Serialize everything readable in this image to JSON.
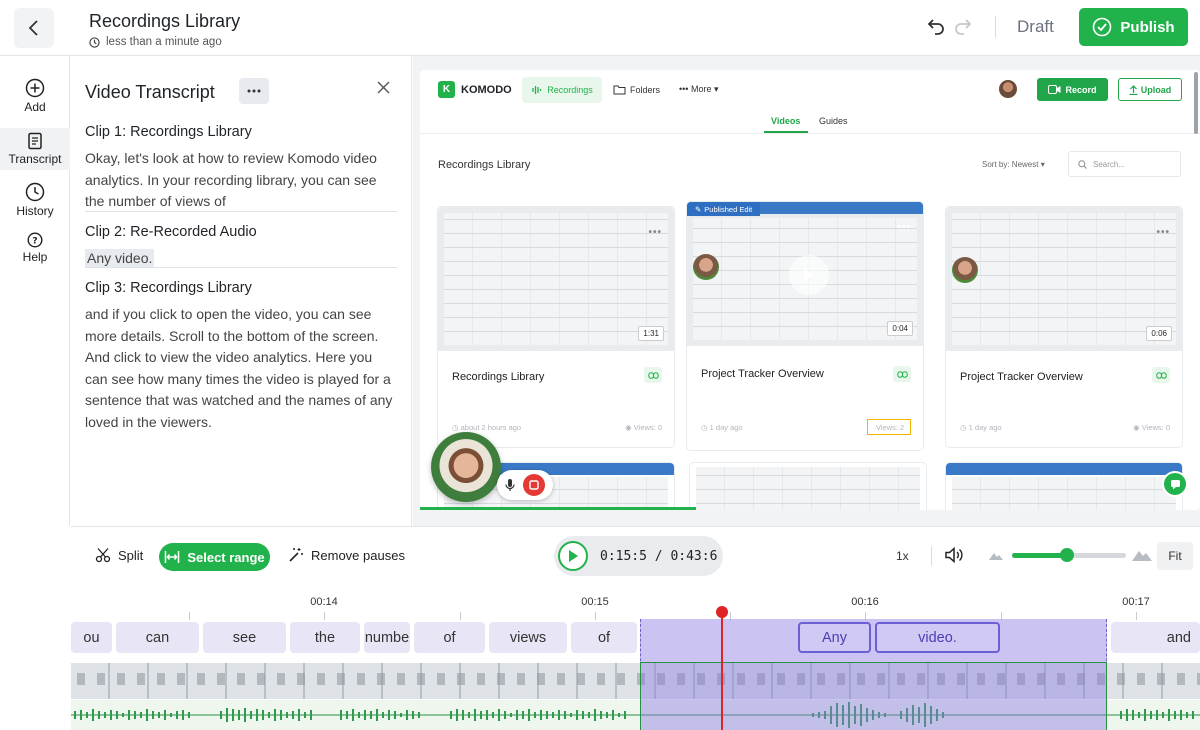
{
  "header": {
    "title": "Recordings Library",
    "subtitle": "less than a minute ago",
    "status": "Draft",
    "publish_label": "Publish"
  },
  "rail": {
    "items": [
      {
        "label": "Add"
      },
      {
        "label": "Transcript"
      },
      {
        "label": "History"
      },
      {
        "label": "Help"
      }
    ]
  },
  "transcript": {
    "title": "Video Transcript",
    "clips": [
      {
        "heading": "Clip 1: Recordings Library",
        "text": "Okay, let's look at how to review Komodo video analytics. In your recording library, you can see the number of views of"
      },
      {
        "heading": "Clip 2: Re-Recorded Audio",
        "text": "Any video."
      },
      {
        "heading": "Clip 3: Recordings Library",
        "text": "and if you click to open the video, you can see more details. Scroll to the bottom of the screen. And click to view the video analytics. Here you can see how many times the video is played for a sentence that was watched and the names of any loved in the viewers."
      }
    ]
  },
  "preview": {
    "brand": "KOMODO",
    "nav": {
      "recordings": "Recordings",
      "folders": "Folders",
      "more": "More",
      "record": "Record",
      "upload": "Upload"
    },
    "tabs": {
      "videos": "Videos",
      "guides": "Guides"
    },
    "library_title": "Recordings Library",
    "sort": "Sort by: Newest",
    "search_placeholder": "Search...",
    "cards": [
      {
        "name": "Recordings Library",
        "duration": "1:31",
        "age": "about 2 hours ago",
        "views": "Views: 0"
      },
      {
        "name": "Project Tracker Overview",
        "duration": "0:04",
        "age": "1 day ago",
        "views": "Views: 2",
        "badge": "Published Edit"
      },
      {
        "name": "Project Tracker Overview",
        "duration": "0:06",
        "age": "1 day ago",
        "views": "Views: 0"
      }
    ]
  },
  "toolbar": {
    "split": "Split",
    "select_range": "Select range",
    "remove_pauses": "Remove pauses",
    "current_time": "0:15:5",
    "total_time": "0:43:6",
    "speed": "1x",
    "zoom_level": 0.48,
    "fit": "Fit"
  },
  "timeline": {
    "ruler": [
      "00:14",
      "00:15",
      "00:16",
      "00:17"
    ],
    "words": [
      "ou",
      "can",
      "see",
      "the",
      "numbe",
      "of",
      "views",
      "of",
      "Any",
      "video.",
      "and"
    ]
  },
  "colors": {
    "accent": "#22b24c",
    "selection": "#8b7ce2",
    "playhead": "#e02424"
  }
}
